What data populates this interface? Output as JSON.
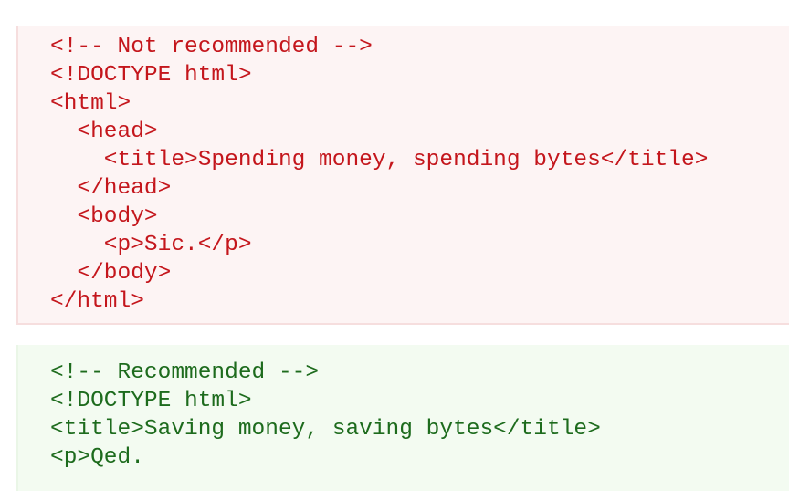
{
  "not_recommended": {
    "lines": [
      "<!-- Not recommended -->",
      "<!DOCTYPE html>",
      "<html>",
      "  <head>",
      "    <title>Spending money, spending bytes</title>",
      "  </head>",
      "  <body>",
      "    <p>Sic.</p>",
      "  </body>",
      "</html>"
    ],
    "text_color": "#c4161c",
    "background_color": "#fdf4f4"
  },
  "recommended": {
    "lines": [
      "<!-- Recommended -->",
      "<!DOCTYPE html>",
      "<title>Saving money, saving bytes</title>",
      "<p>Qed."
    ],
    "text_color": "#1d6b1d",
    "background_color": "#f3fbf1"
  }
}
